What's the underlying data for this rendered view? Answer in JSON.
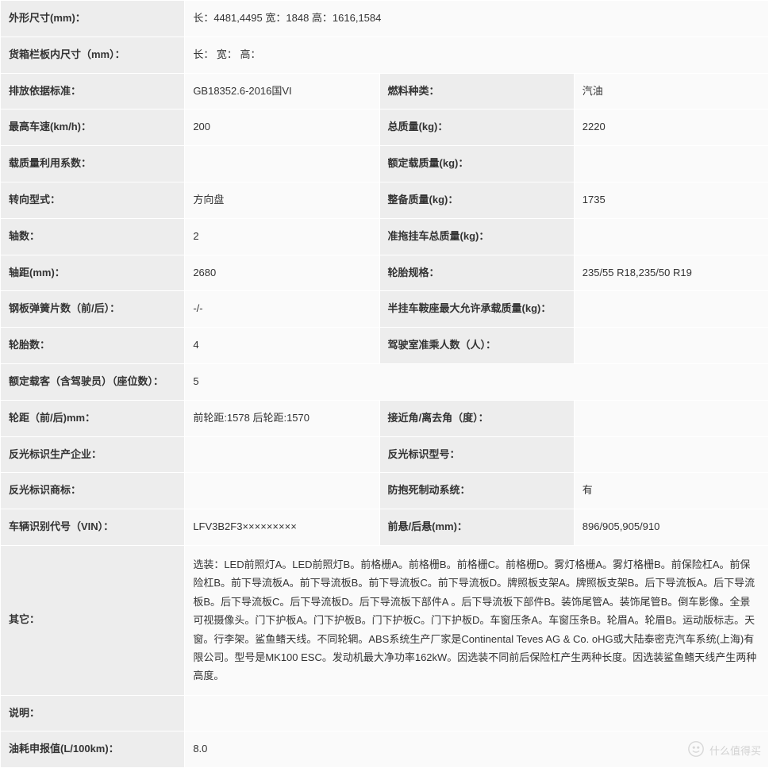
{
  "rows": {
    "dimensions_label": "外形尺寸(mm)：",
    "dimensions_value": "长：4481,4495 宽：1848 高：1616,1584",
    "cargo_box_label": "货箱栏板内尺寸（mm）：",
    "cargo_box_value": "长：  宽：  高：",
    "emission_label": "排放依据标准：",
    "emission_value": "GB18352.6-2016国VI",
    "fuel_type_label": "燃料种类：",
    "fuel_type_value": "汽油",
    "max_speed_label": "最高车速(km/h)：",
    "max_speed_value": "200",
    "gross_mass_label": "总质量(kg)：",
    "gross_mass_value": "2220",
    "load_util_label": "载质量利用系数：",
    "load_util_value": "",
    "rated_load_label": "额定载质量(kg)：",
    "rated_load_value": "",
    "steering_label": "转向型式：",
    "steering_value": "方向盘",
    "curb_mass_label": "整备质量(kg)：",
    "curb_mass_value": "1735",
    "axle_count_label": "轴数：",
    "axle_count_value": "2",
    "trailer_mass_label": "准拖挂车总质量(kg)：",
    "trailer_mass_value": "",
    "wheelbase_label": "轴距(mm)：",
    "wheelbase_value": "2680",
    "tire_spec_label": "轮胎规格：",
    "tire_spec_value": "235/55 R18,235/50 R19",
    "leaf_spring_label": "钢板弹簧片数（前/后）：",
    "leaf_spring_value": "-/-",
    "fifth_wheel_label": "半挂车鞍座最大允许承载质量(kg)：",
    "fifth_wheel_value": "",
    "tire_count_label": "轮胎数：",
    "tire_count_value": "4",
    "cab_seats_label": "驾驶室准乘人数（人）：",
    "cab_seats_value": "",
    "rated_pass_label": "额定载客（含驾驶员）（座位数）：",
    "rated_pass_value": "5",
    "track_label": "轮距（前/后)mm：",
    "track_value": "前轮距:1578 后轮距:1570",
    "approach_label": "接近角/离去角（度）：",
    "approach_value": "",
    "reflector_mfr_label": "反光标识生产企业：",
    "reflector_mfr_value": "",
    "reflector_model_label": "反光标识型号：",
    "reflector_model_value": "",
    "reflector_brand_label": "反光标识商标：",
    "reflector_brand_value": "",
    "abs_label": "防抱死制动系统：",
    "abs_value": "有",
    "vin_label": "车辆识别代号（VIN）：",
    "vin_value": "LFV3B2F3×××××××××",
    "overhang_label": "前悬/后悬(mm)：",
    "overhang_value": "896/905,905/910",
    "other_label": "其它：",
    "other_value": "选装：LED前照灯A。LED前照灯B。前格栅A。前格栅B。前格栅C。前格栅D。雾灯格栅A。雾灯格栅B。前保险杠A。前保险杠B。前下导流板A。前下导流板B。前下导流板C。前下导流板D。牌照板支架A。牌照板支架B。后下导流板A。后下导流板B。后下导流板C。后下导流板D。后下导流板下部件A 。后下导流板下部件B。装饰尾管A。装饰尾管B。倒车影像。全景可视摄像头。门下护板A。门下护板B。门下护板C。门下护板D。车窗压条A。车窗压条B。轮眉A。轮眉B。运动版标志。天窗。行李架。鲨鱼鳍天线。不同轮辋。ABS系统生产厂家是Continental Teves AG & Co. oHG或大陆泰密克汽车系统(上海)有限公司。型号是MK100 ESC。发动机最大净功率162kW。因选装不同前后保险杠产生两种长度。因选装鲨鱼鳍天线产生两种高度。",
    "remark_label": "说明：",
    "remark_value": "",
    "fuel_consumption_label": "油耗申报值(L/100km)：",
    "fuel_consumption_value": "8.0"
  },
  "watermark_text": "什么值得买"
}
